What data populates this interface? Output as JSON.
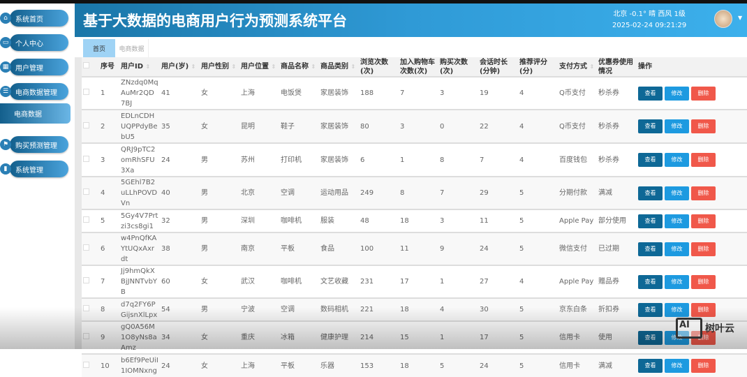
{
  "header": {
    "title": "基于大数据的电商用户行为预测系统平台",
    "weather": "北京 -0.1° 晴 西风 1级",
    "datetime": "2025-02-24 09:21:29"
  },
  "sidebar": {
    "items": [
      {
        "label": "系统首页",
        "icon": "home-icon"
      },
      {
        "label": "个人中心",
        "icon": "profile-icon"
      },
      {
        "label": "用户管理",
        "icon": "grid-icon"
      },
      {
        "label": "电商数据管理",
        "icon": "list-icon"
      },
      {
        "label": "购买预测管理",
        "icon": "flag-icon"
      },
      {
        "label": "系统管理",
        "icon": "chart-icon"
      }
    ],
    "sub_item": "电商数据"
  },
  "tabs": [
    "首页",
    "电商数据"
  ],
  "table": {
    "headers": [
      "序号",
      "用户ID",
      "用户(岁)",
      "用户性别",
      "用户位置",
      "商品名称",
      "商品类别",
      "浏览次数(次)",
      "加入购物车次数(次)",
      "购买次数(次)",
      "会话时长(分钟)",
      "推荐评分(分)",
      "支付方式",
      "优惠券使用情况",
      "操作"
    ],
    "actions": [
      "查看",
      "修改",
      "删除"
    ],
    "rows": [
      [
        "1",
        "ZNzdq0MqAuMr2QD7BJ",
        "41",
        "女",
        "上海",
        "电饭煲",
        "家居装饰",
        "188",
        "7",
        "3",
        "19",
        "4",
        "Q币支付",
        "秒杀券"
      ],
      [
        "2",
        "EDLnCDHUQPPdyBebU5",
        "35",
        "女",
        "昆明",
        "鞋子",
        "家居装饰",
        "80",
        "3",
        "0",
        "22",
        "4",
        "Q币支付",
        "秒杀券"
      ],
      [
        "3",
        "QRJ9pTC2omRhSFU3Xa",
        "24",
        "男",
        "苏州",
        "打印机",
        "家居装饰",
        "6",
        "1",
        "8",
        "7",
        "4",
        "百度钱包",
        "秒杀券"
      ],
      [
        "4",
        "5GEhl7B2uLLhPOVDVn",
        "40",
        "男",
        "北京",
        "空调",
        "运动用品",
        "249",
        "8",
        "7",
        "29",
        "5",
        "分期付款",
        "满减"
      ],
      [
        "5",
        "5Gy4V7Prtzi3cs8gi1",
        "32",
        "男",
        "深圳",
        "咖啡机",
        "服装",
        "48",
        "18",
        "3",
        "11",
        "5",
        "Apple Pay",
        "部分使用"
      ],
      [
        "6",
        "w4PnQfKAYtUQxAxrdt",
        "38",
        "男",
        "南京",
        "平板",
        "食品",
        "100",
        "11",
        "9",
        "24",
        "5",
        "微信支付",
        "已过期"
      ],
      [
        "7",
        "Jj9hmQkXBjJNNTvbYB",
        "60",
        "女",
        "武汉",
        "咖啡机",
        "文艺收藏",
        "231",
        "17",
        "1",
        "27",
        "4",
        "Apple Pay",
        "赠品券"
      ],
      [
        "8",
        "d7q2FY6PGijsnXlLpx",
        "54",
        "男",
        "宁波",
        "空调",
        "数码相机",
        "221",
        "18",
        "4",
        "30",
        "5",
        "京东白条",
        "折扣券"
      ],
      [
        "9",
        "gQ0A56M1O8yNs8aAmz",
        "34",
        "女",
        "重庆",
        "冰箱",
        "健康护理",
        "214",
        "15",
        "1",
        "17",
        "5",
        "信用卡",
        "使用"
      ],
      [
        "10",
        "b6Ef9PeUiI1IOMNxng",
        "24",
        "女",
        "上海",
        "平板",
        "乐器",
        "153",
        "18",
        "5",
        "24",
        "5",
        "信用卡",
        "满减"
      ]
    ]
  },
  "watermark": "树叶云"
}
